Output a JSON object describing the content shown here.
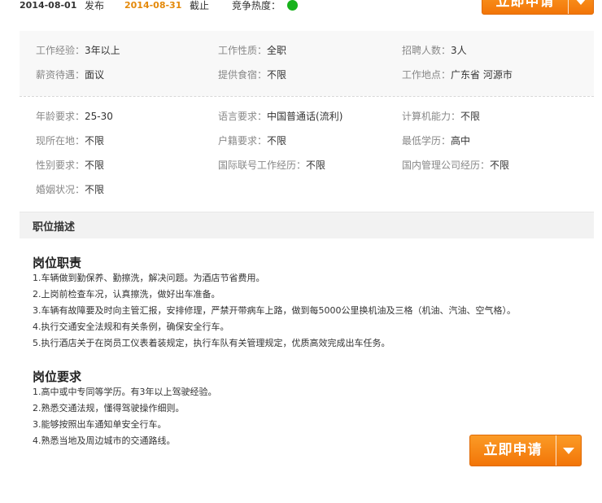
{
  "top": {
    "start_date": "2014-08-01",
    "publish_label": "发布",
    "end_date": "2014-08-31",
    "close_label": "截止",
    "heat_label": "竞争热度：",
    "heat_color": "#17b21b",
    "apply_label": "立即申请"
  },
  "basic": [
    {
      "label": "工作经验：",
      "value": "3年以上"
    },
    {
      "label": "工作性质：",
      "value": "全职"
    },
    {
      "label": "招聘人数：",
      "value": "3人"
    },
    {
      "label": "薪资待遇：",
      "value": "面议"
    },
    {
      "label": "提供食宿：",
      "value": "不限"
    },
    {
      "label": "工作地点：",
      "value": "广东省 河源市"
    }
  ],
  "requirements": [
    {
      "label": "年龄要求：",
      "value": "25-30"
    },
    {
      "label": "语言要求：",
      "value": "中国普通话(流利)"
    },
    {
      "label": "计算机能力：",
      "value": "不限"
    },
    {
      "label": "现所在地：",
      "value": "不限"
    },
    {
      "label": "户籍要求：",
      "value": "不限"
    },
    {
      "label": "最低学历：",
      "value": "高中"
    },
    {
      "label": "性别要求：",
      "value": "不限"
    },
    {
      "label": "国际联号工作经历：",
      "value": "不限"
    },
    {
      "label": "国内管理公司经历：",
      "value": "不限"
    },
    {
      "label": "婚姻状况：",
      "value": "不限"
    }
  ],
  "section_title": "职位描述",
  "duties": {
    "heading": "岗位职责",
    "items": [
      "1.车辆做到勤保养、勤擦洗，解决问题。为酒店节省费用。",
      "2.上岗前检查车况，认真擦洗，做好出车准备。",
      "3.车辆有故障要及时向主管汇报，安排修理，严禁开带病车上路，做到每5000公里换机油及三格（机油、汽油、空气格）。",
      "4.执行交通安全法规和有关条例，确保安全行车。",
      "5.执行酒店关于在岗员工仪表着装规定，执行车队有关管理规定，优质高效完成出车任务。"
    ]
  },
  "reqs": {
    "heading": "岗位要求",
    "items": [
      "1.高中或中专同等学历。有3年以上驾驶经验。",
      "2.熟悉交通法规，懂得驾驶操作细则。",
      "3.能够按照出车通知单安全行车。",
      "4.熟悉当地及周边城市的交通路线。"
    ]
  },
  "apply_bottom_label": "立即申请"
}
